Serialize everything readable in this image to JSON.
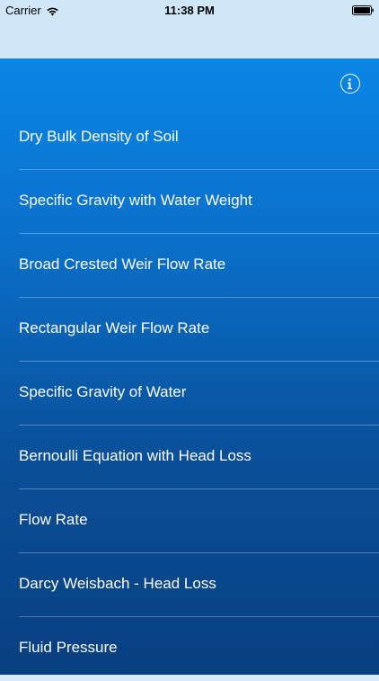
{
  "status_bar": {
    "carrier": "Carrier",
    "time": "11:38 PM"
  },
  "icons": {
    "wifi": "wifi-icon",
    "battery": "battery-icon",
    "info": "info-icon"
  },
  "colors": {
    "background_top": "#0a86e6",
    "background_bottom": "#083f80",
    "nav_bar": "#cfe7f7",
    "text": "#ffffff"
  },
  "menu": {
    "items": [
      {
        "label": "Dry Bulk Density of Soil"
      },
      {
        "label": "Specific Gravity with Water Weight"
      },
      {
        "label": "Broad Crested Weir Flow Rate"
      },
      {
        "label": "Rectangular Weir Flow Rate"
      },
      {
        "label": "Specific Gravity of Water"
      },
      {
        "label": "Bernoulli Equation with Head Loss"
      },
      {
        "label": "Flow Rate"
      },
      {
        "label": "Darcy Weisbach - Head Loss"
      },
      {
        "label": "Fluid Pressure"
      }
    ]
  }
}
